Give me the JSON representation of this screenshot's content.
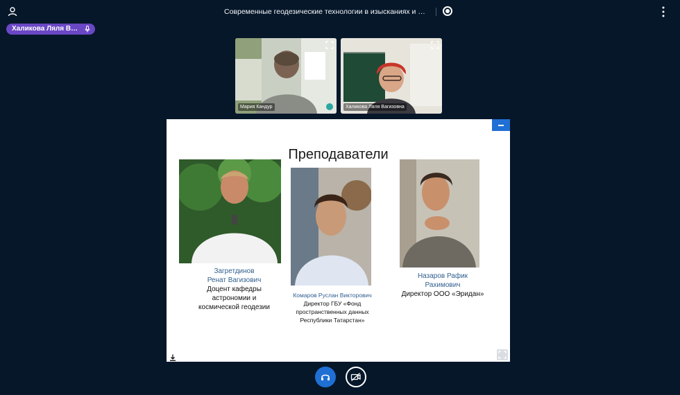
{
  "header": {
    "title": "Современные геодезические технологии в изысканиях и стро..."
  },
  "talker": {
    "name": "Халикова Ляля Ваг..."
  },
  "videos": [
    {
      "name": "Мария Кандур"
    },
    {
      "name": "Халикова Ляля Вагизовна"
    }
  ],
  "slide": {
    "title": "Преподаватели",
    "teachers": [
      {
        "name_line1": "Загретдинов",
        "name_line2": "Ренат Вагизович",
        "role_lines": [
          "Доцент кафедры",
          "астрономии и",
          "космической геодезии"
        ]
      },
      {
        "name_line1": "Комаров Руслан Викторович",
        "role_lines": [
          "Директор ГБУ «Фонд",
          "пространственных данных",
          "Республики Татарстан»"
        ]
      },
      {
        "name_line1": "Назаров Рафик",
        "name_line2": "Рахимович",
        "role_lines": [
          "Директор ООО «Эридан»"
        ]
      }
    ]
  },
  "icons": {
    "users": "user-icon",
    "record": "record-icon",
    "options": "more-vertical-icon",
    "mic": "microphone-icon",
    "fullscreen": "fullscreen-icon",
    "download": "download-icon",
    "audio": "headphones-icon",
    "video": "video-off-icon",
    "minimize": "minimize-icon"
  },
  "colors": {
    "background": "#06172a",
    "accent": "#1f6fd4",
    "talker": "#6a47c4",
    "name_blue": "#2f5e8e"
  }
}
